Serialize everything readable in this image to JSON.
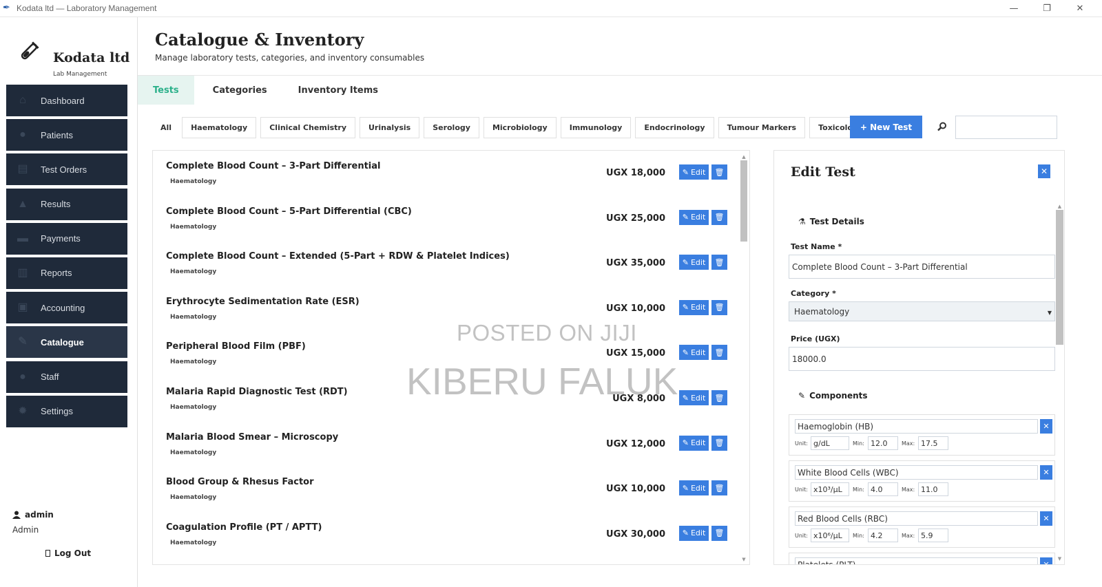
{
  "window": {
    "title": "Kodata ltd — Laboratory Management",
    "controls": [
      "—",
      "❐",
      "✕"
    ]
  },
  "brand": {
    "name": "Kodata ltd",
    "subtitle": "Lab Management"
  },
  "nav": [
    {
      "label": "Dashboard",
      "icon": "dashboard-icon"
    },
    {
      "label": "Patients",
      "icon": "user-icon"
    },
    {
      "label": "Test Orders",
      "icon": "clipboard-icon"
    },
    {
      "label": "Results",
      "icon": "flask-icon"
    },
    {
      "label": "Payments",
      "icon": "card-icon"
    },
    {
      "label": "Reports",
      "icon": "bar-chart-icon"
    },
    {
      "label": "Accounting",
      "icon": "ledger-icon"
    },
    {
      "label": "Catalogue",
      "icon": "syringe-icon",
      "active": true
    },
    {
      "label": "Staff",
      "icon": "users-icon"
    },
    {
      "label": "Settings",
      "icon": "gear-icon"
    }
  ],
  "user": {
    "name": "admin",
    "role": "Admin",
    "logout": "Log Out"
  },
  "header": {
    "title": "Catalogue & Inventory",
    "subtitle": "Manage laboratory tests, categories, and inventory consumables"
  },
  "tabs": [
    {
      "label": "Tests",
      "active": true
    },
    {
      "label": "Categories"
    },
    {
      "label": "Inventory Items"
    }
  ],
  "filters": [
    "All",
    "Haematology",
    "Clinical Chemistry",
    "Urinalysis",
    "Serology",
    "Microbiology",
    "Immunology",
    "Endocrinology",
    "Tumour Markers",
    "Toxicology"
  ],
  "new_test_label": "+ New Test",
  "search": {
    "value": "",
    "placeholder": ""
  },
  "tests": [
    {
      "name": "Complete Blood Count – 3-Part Differential",
      "category": "Haematology",
      "price": "UGX 18,000"
    },
    {
      "name": "Complete Blood Count – 5-Part Differential (CBC)",
      "category": "Haematology",
      "price": "UGX 25,000"
    },
    {
      "name": "Complete Blood Count – Extended (5-Part + RDW & Platelet Indices)",
      "category": "Haematology",
      "price": "UGX 35,000"
    },
    {
      "name": "Erythrocyte Sedimentation Rate (ESR)",
      "category": "Haematology",
      "price": "UGX 10,000"
    },
    {
      "name": "Peripheral Blood Film (PBF)",
      "category": "Haematology",
      "price": "UGX 15,000"
    },
    {
      "name": "Malaria Rapid Diagnostic Test (RDT)",
      "category": "Haematology",
      "price": "UGX 8,000"
    },
    {
      "name": "Malaria Blood Smear – Microscopy",
      "category": "Haematology",
      "price": "UGX 12,000"
    },
    {
      "name": "Blood Group & Rhesus Factor",
      "category": "Haematology",
      "price": "UGX 10,000"
    },
    {
      "name": "Coagulation Profile (PT / APTT)",
      "category": "Haematology",
      "price": "UGX 30,000"
    }
  ],
  "row_actions": {
    "edit": "Edit",
    "delete_icon": "trash-icon"
  },
  "watermark": {
    "line1": "POSTED ON JIJI",
    "line2": "KIBERU FALUK"
  },
  "edit_panel": {
    "title": "Edit Test",
    "close": "✕",
    "details_heading": "Test Details",
    "test_name_label": "Test Name *",
    "test_name_value": "Complete Blood Count – 3-Part Differential",
    "category_label": "Category *",
    "category_value": "Haematology",
    "price_label": "Price (UGX)",
    "price_value": "18000.0",
    "components_heading": "Components",
    "unit_label": "Unit:",
    "min_label": "Min:",
    "max_label": "Max:",
    "components": [
      {
        "name": "Haemoglobin (HB)",
        "unit": "g/dL",
        "min": "12.0",
        "max": "17.5"
      },
      {
        "name": "White Blood Cells (WBC)",
        "unit": "x10³/µL",
        "min": "4.0",
        "max": "11.0"
      },
      {
        "name": "Red Blood Cells (RBC)",
        "unit": "x10⁶/µL",
        "min": "4.2",
        "max": "5.9"
      },
      {
        "name": "Platelets (PLT)",
        "unit": "",
        "min": "",
        "max": ""
      }
    ]
  },
  "colors": {
    "sidebar_nav": "#1f2a3a",
    "accent_blue": "#3a7ee0",
    "tab_active": "#2bb08a",
    "tab_active_bg": "#e6f4f0"
  }
}
